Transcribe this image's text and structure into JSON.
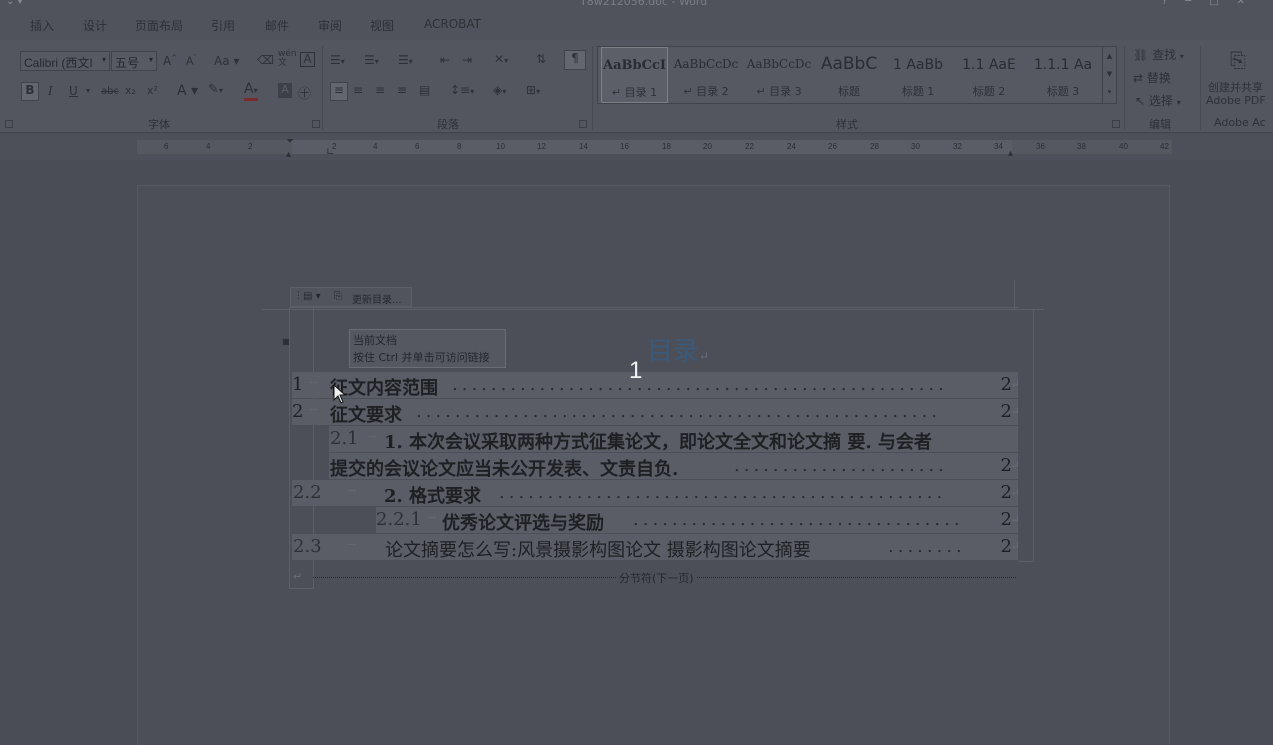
{
  "window": {
    "title": "T8w212056.doc - Word"
  },
  "tabs": [
    {
      "label": "插入"
    },
    {
      "label": "设计"
    },
    {
      "label": "页面布局"
    },
    {
      "label": "引用"
    },
    {
      "label": "邮件"
    },
    {
      "label": "审阅"
    },
    {
      "label": "视图"
    },
    {
      "label": "ACROBAT"
    }
  ],
  "ribbon": {
    "font": {
      "font_name": "Calibri (西文I",
      "font_size": "五号",
      "group_label": "字体",
      "grow_label": "A",
      "shrink_label": "A",
      "case_label": "Aa",
      "bold": "B",
      "italic": "I",
      "underline": "U",
      "strike": "abc",
      "subscript": "x₂",
      "superscript": "x²",
      "font_color_label": "A",
      "wen_label": "wén"
    },
    "paragraph": {
      "group_label": "段落"
    },
    "styles": {
      "group_label": "样式",
      "items": [
        {
          "sample": "AaBbCcI",
          "name": "目录 1"
        },
        {
          "sample": "AaBbCcDc",
          "name": "目录 2"
        },
        {
          "sample": "AaBbCcDc",
          "name": "目录 3"
        },
        {
          "sample": "AaBbC",
          "name": "标题"
        },
        {
          "sample": "1  AaBb",
          "name": "标题 1"
        },
        {
          "sample": "1.1  AaE",
          "name": "标题 2"
        },
        {
          "sample": "1.1.1  Aa",
          "name": "标题 3"
        }
      ]
    },
    "editing": {
      "group_label": "编辑",
      "find": "查找",
      "replace": "替换",
      "select": "选择"
    },
    "adobe": {
      "create_label_1": "创建并共享",
      "create_label_2": "Adobe PDF",
      "group_label": "Adobe Ac"
    }
  },
  "ruler": {
    "ticks": [
      "6",
      "4",
      "2",
      "2",
      "4",
      "6",
      "8",
      "10",
      "12",
      "14",
      "16",
      "18",
      "20",
      "22",
      "24",
      "26",
      "28",
      "30",
      "32",
      "34",
      "36",
      "38",
      "40",
      "42"
    ]
  },
  "document": {
    "toc_control": {
      "update_label": "更新目录..."
    },
    "tooltip": {
      "line1": "当前文档",
      "line2": "按住 Ctrl 并单击可访问链接"
    },
    "toc_title": "目录",
    "page_badge": "1",
    "toc_entries": [
      {
        "num": "1",
        "text": "征文内容范围",
        "page": "2"
      },
      {
        "num": "2",
        "text": "征文要求",
        "page": "2"
      },
      {
        "num": "2.1",
        "text": "1.  本次会议采取两种方式征集论文，即论文全文和论文摘  要. 与会者",
        "page": ""
      },
      {
        "num": "",
        "text": "提交的会议论文应当未公开发表、文责自负.",
        "page": "2"
      },
      {
        "num": "2.2",
        "text": "2.  格式要求",
        "page": "2"
      },
      {
        "num": "2.2.1",
        "text": "优秀论文评选与奖励",
        "page": "2"
      },
      {
        "num": "2.3",
        "text": "论文摘要怎么写:风景摄影构图论文  摄影构图论文摘要",
        "page": "2"
      }
    ],
    "section_break": "分节符(下一页)"
  },
  "colors": {
    "overlay": "#4a4d56",
    "toc_title": "#3b5a7a",
    "selection": "#5a5d65"
  }
}
